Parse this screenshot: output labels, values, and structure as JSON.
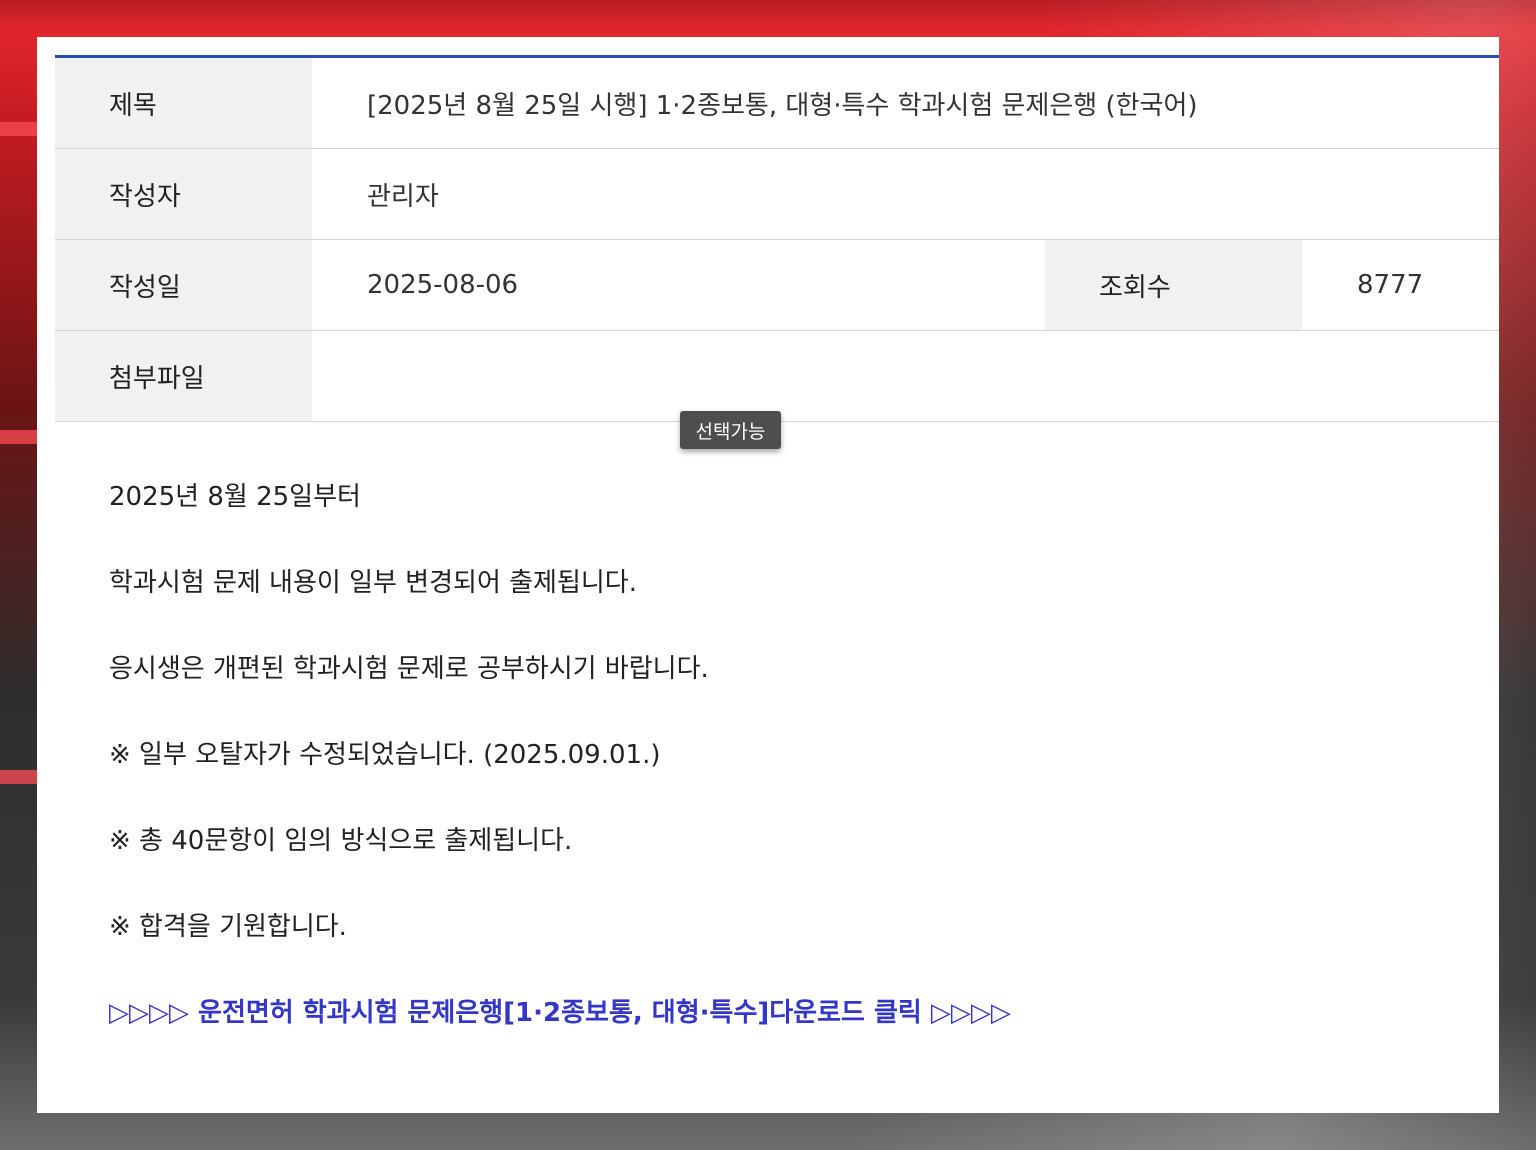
{
  "post": {
    "title_label": "제목",
    "title": "[2025년 8월 25일 시행] 1·2종보통, 대형·특수 학과시험 문제은행 (한국어)",
    "author_label": "작성자",
    "author": "관리자",
    "date_label": "작성일",
    "date": "2025-08-06",
    "views_label": "조회수",
    "views": "8777",
    "attachment_label": "첨부파일",
    "attachment": ""
  },
  "tooltip": "선택가능",
  "content": {
    "paragraphs": [
      "2025년 8월 25일부터",
      "학과시험 문제 내용이 일부 변경되어 출제됩니다.",
      "응시생은 개편된 학과시험 문제로 공부하시기 바랍니다.",
      "※ 일부 오탈자가 수정되었습니다. (2025.09.01.)",
      "※ 총 40문항이 임의 방식으로 출제됩니다.",
      "※ 합격을 기원합니다."
    ],
    "download_link": "▷▷▷▷ 운전면허 학과시험 문제은행[1·2종보통, 대형·특수]다운로드 클릭 ▷▷▷▷"
  },
  "colors": {
    "accent_line": "#2450a8",
    "link": "#3436c8",
    "header_bg": "#f1f1f1"
  }
}
